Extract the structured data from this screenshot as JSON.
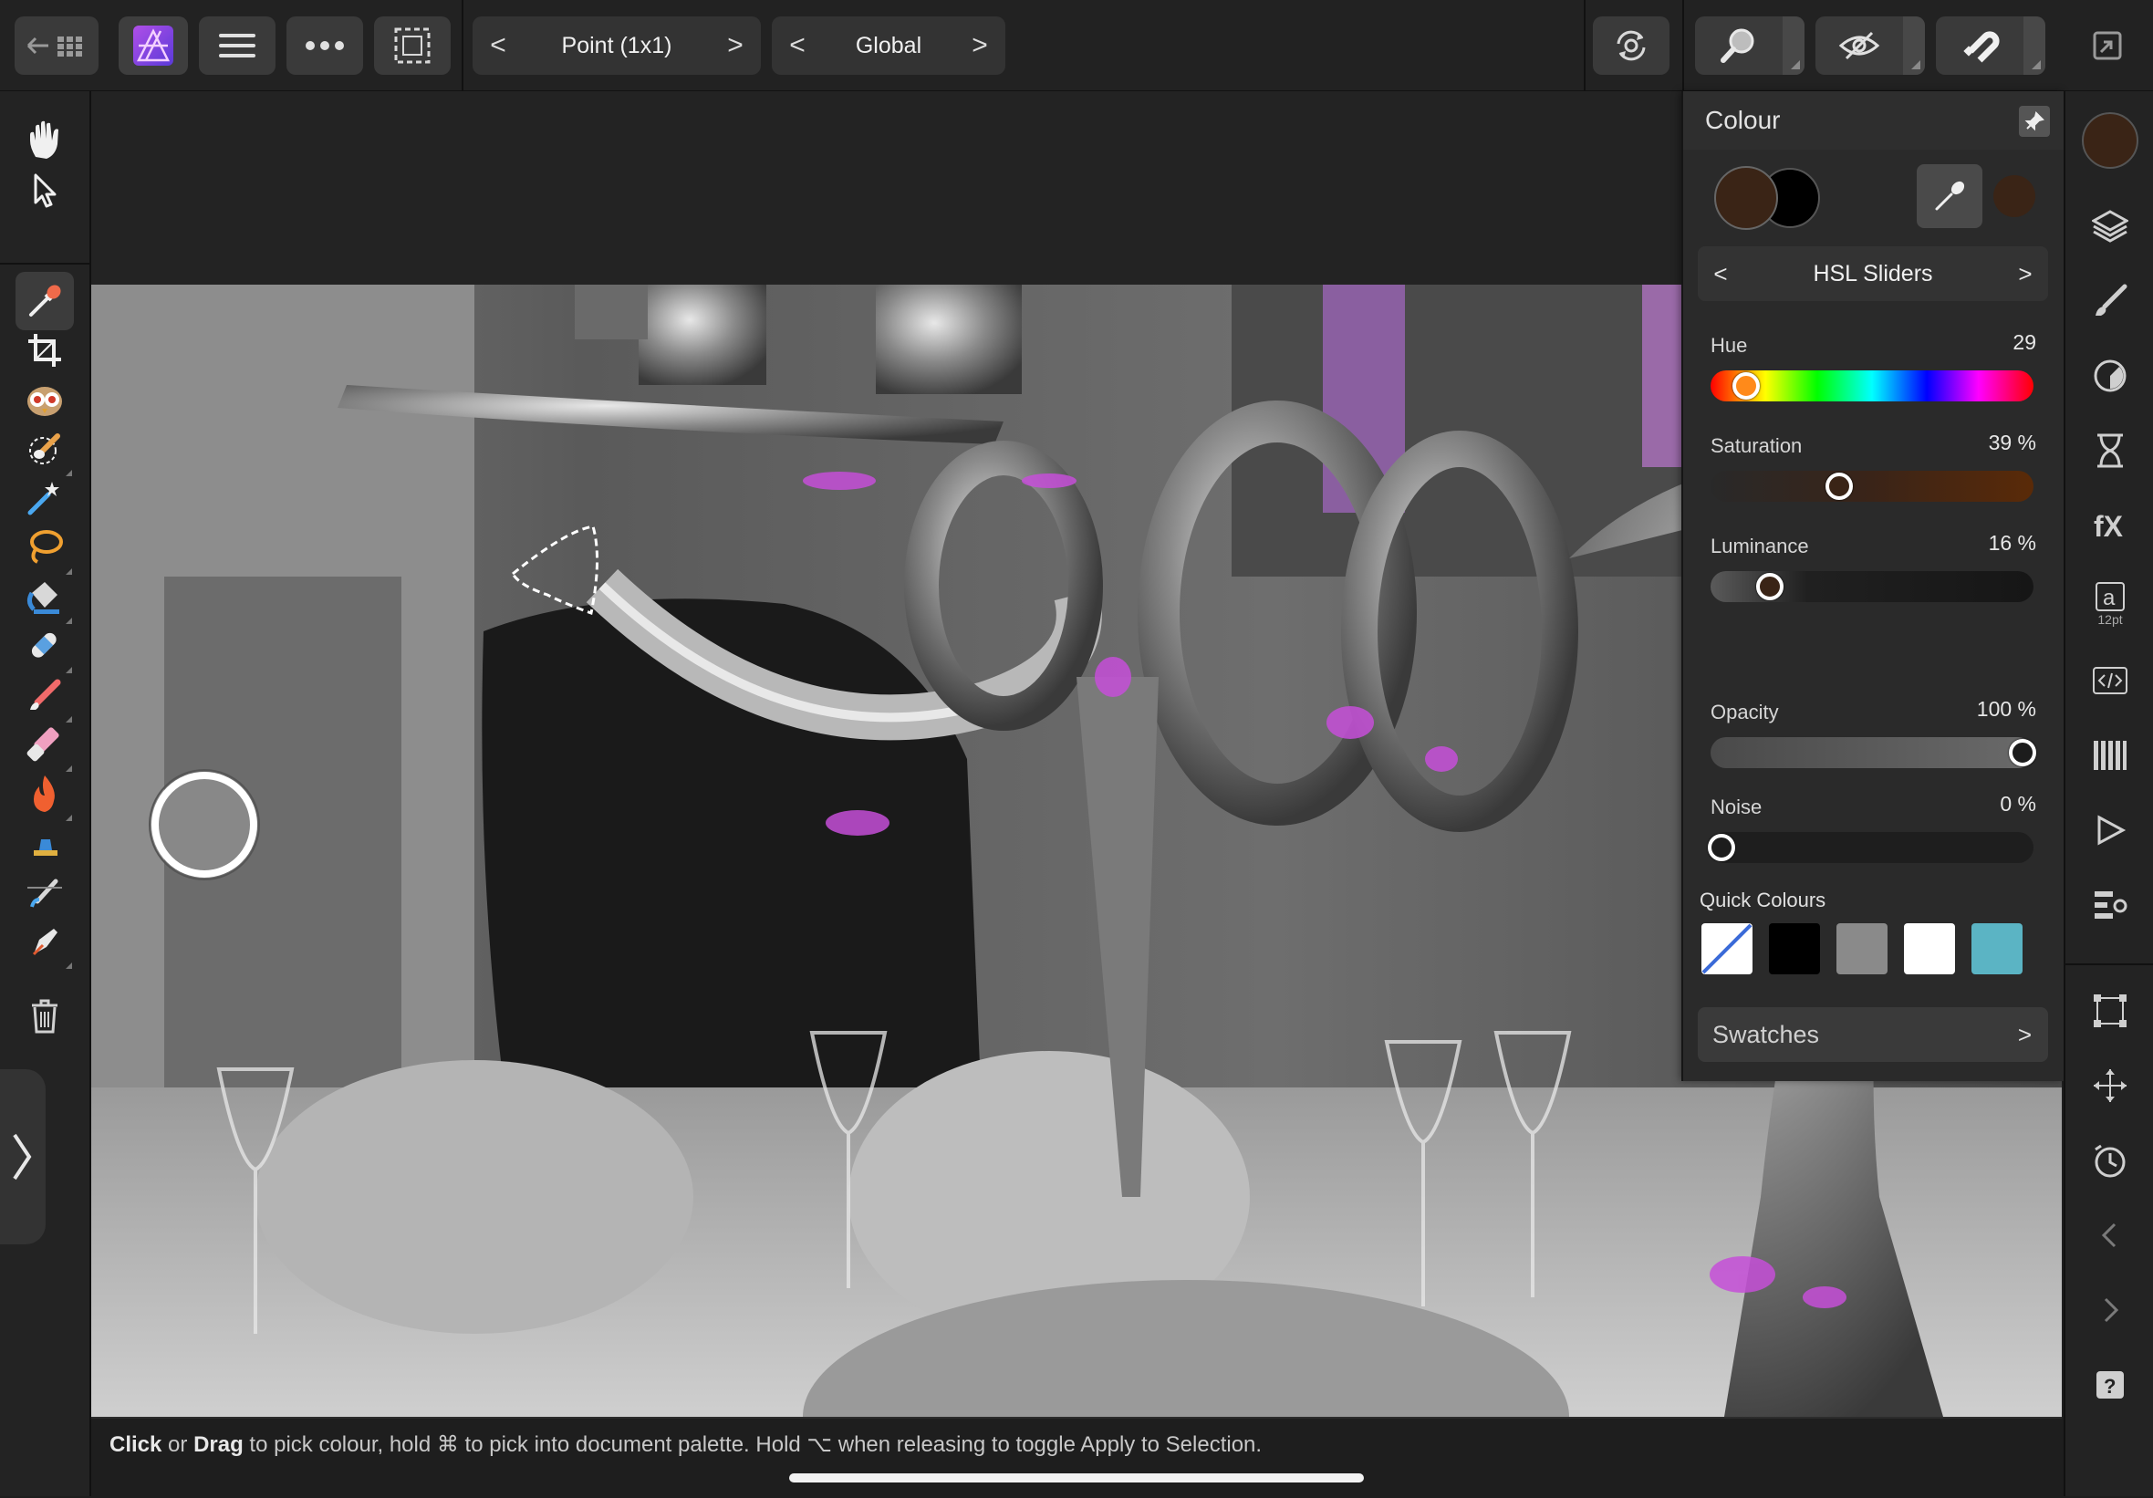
{
  "topbar": {
    "assistant_picker": {
      "label": "Point (1x1)",
      "prev": "<",
      "next": ">"
    },
    "scope_picker": {
      "label": "Global",
      "prev": "<",
      "next": ">"
    }
  },
  "colour_panel": {
    "title": "Colour",
    "mode": {
      "label": "HSL Sliders",
      "prev": "<",
      "next": ">"
    },
    "primary_color": "#3a2416",
    "secondary_color": "#000000",
    "sliders": [
      {
        "label": "Hue",
        "value": "29",
        "fraction": 0.081
      },
      {
        "label": "Saturation",
        "value": "39 %",
        "fraction": 0.39
      },
      {
        "label": "Luminance",
        "value": "16 %",
        "fraction": 0.16
      },
      {
        "label": "Opacity",
        "value": "100 %",
        "fraction": 1.0
      },
      {
        "label": "Noise",
        "value": "0 %",
        "fraction": 0.0
      }
    ],
    "quick_colours": {
      "label": "Quick Colours",
      "swatches": [
        "none",
        "#000000",
        "#8a8a8a",
        "#ffffff",
        "#5bb4c4"
      ]
    },
    "swatches_label": "Swatches",
    "swatches_arrow": ">"
  },
  "statusbar": {
    "hint_click": "Click",
    "hint_or": " or ",
    "hint_drag": "Drag",
    "hint_rest": " to pick colour, hold ⌘ to pick into document palette. Hold ⌥ when releasing to toggle Apply to Selection."
  },
  "rightbar": {
    "text_size_label": "12pt"
  },
  "icons": {
    "back": "back-arrow-icon",
    "app": "affinity-photo-logo",
    "menu": "hamburger-menu-icon",
    "more": "more-dots-icon",
    "selection": "selection-marquee-icon"
  }
}
